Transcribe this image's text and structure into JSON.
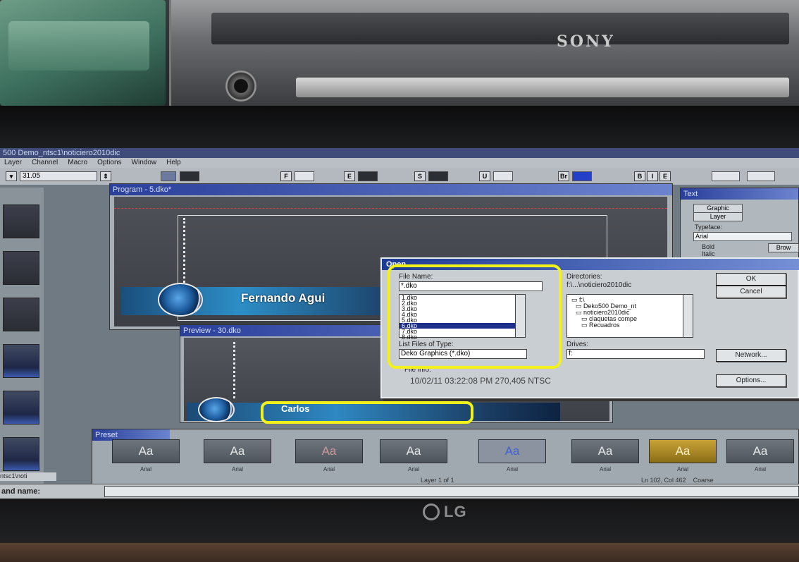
{
  "scene": {
    "monitor_above_brand": "SONY",
    "monitor_brand": "LG"
  },
  "app": {
    "title": "500 Demo_ntsc1\\noticiero2010dic",
    "menu": [
      "Layer",
      "Channel",
      "Macro",
      "Options",
      "Window",
      "Help"
    ],
    "toolbar": {
      "size_value": "31.05",
      "btn_f": "F",
      "btn_b": "B",
      "btn_i": "I",
      "btn_e": "E"
    }
  },
  "program_window": {
    "title": "Program - 5.dko*",
    "lower_third_name": "Fernando Agui"
  },
  "preview_window": {
    "title": "Preview - 30.dko",
    "lower_third_name": "Carlos"
  },
  "text_panel": {
    "title": "Text",
    "tabs": [
      "Graphic",
      "Layer"
    ],
    "typeface_label": "Typeface:",
    "typeface_value": "Arial",
    "bold_label": "Bold",
    "italic_label": "Italic",
    "browse_label": "Brow"
  },
  "presets": {
    "title": "Preset",
    "items": [
      {
        "glyph": "Aa",
        "label": "Arial"
      },
      {
        "glyph": "Aa",
        "label": "Arial"
      },
      {
        "glyph": "Aa",
        "label": "Arial"
      },
      {
        "glyph": "Aa",
        "label": "Arial"
      },
      {
        "glyph": "Aa",
        "label": "Arial"
      },
      {
        "glyph": "Aa",
        "label": "Arial"
      },
      {
        "glyph": "Aa",
        "label": "Arial"
      },
      {
        "glyph": "Aa",
        "label": "Arial"
      }
    ]
  },
  "open_dialog": {
    "title": "Open",
    "file_name_label": "File Name:",
    "file_name_value": "*.dko",
    "files": [
      "1.dko",
      "2.dko",
      "3.dko",
      "4.dko",
      "5.dko",
      "6.dko",
      "7.dko",
      "8.dko"
    ],
    "selected_file_index": 5,
    "directories_label": "Directories:",
    "directories_path": "f:\\...\\noticiero2010dic",
    "dirs": [
      "f:\\",
      "Deko500 Demo_nt",
      "noticiero2010dic",
      "claquetas compe",
      "Recuadros"
    ],
    "list_type_label": "List Files of Type:",
    "list_type_value": "Deko Graphics (*.dko)",
    "drives_label": "Drives:",
    "drives_value": "f:",
    "file_info_label": "File info:",
    "file_info_value": "10/02/11 03:22:08 PM 270,405 NTSC",
    "ok": "OK",
    "cancel": "Cancel",
    "network": "Network...",
    "options": "Options..."
  },
  "status": {
    "left_path": "ntsc1\\noti",
    "layer": "Layer 1 of 1",
    "position": "Ln 102, Col 462",
    "mode": "Coarse",
    "command_label": "and name:"
  },
  "colors": {
    "annotation": "#f2f21a",
    "title_bar": "#1d3a94",
    "selection": "#1d2f8a"
  }
}
